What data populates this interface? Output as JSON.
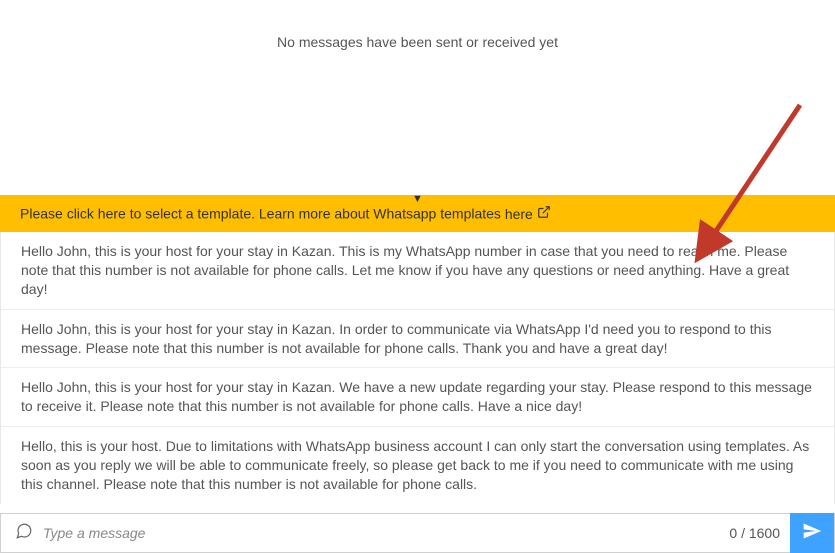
{
  "empty_message": "No messages have been sent or received yet",
  "banner": {
    "prefix": "Please click here to select a template. Learn more about Whatsapp templates",
    "link_label": "here"
  },
  "templates": [
    "Hello John, this is your host for your stay in Kazan. This is my WhatsApp number in case that you need to reach me. Please note that this number is not available for phone calls. Let me know if you have any questions or need anything. Have a great day!",
    "Hello John, this is your host for your stay in Kazan. In order to communicate via WhatsApp I'd need you to respond to this message. Please note that this number is not available for phone calls. Thank you and have a great day!",
    "Hello John, this is your host for your stay in Kazan. We have a new update regarding your stay. Please respond to this message to receive it. Please note that this number is not available for phone calls. Have a nice day!",
    "Hello, this is your host. Due to limitations with WhatsApp business account I can only start the conversation using templates. As soon as you reply we will be able to communicate freely, so please get back to me if you need to communicate with me using this channel. Please note that this number is not available for phone calls."
  ],
  "compose": {
    "placeholder": "Type a message",
    "char_count": "0 / 1600"
  },
  "annotation": {
    "arrow_color": "#c0392b"
  }
}
